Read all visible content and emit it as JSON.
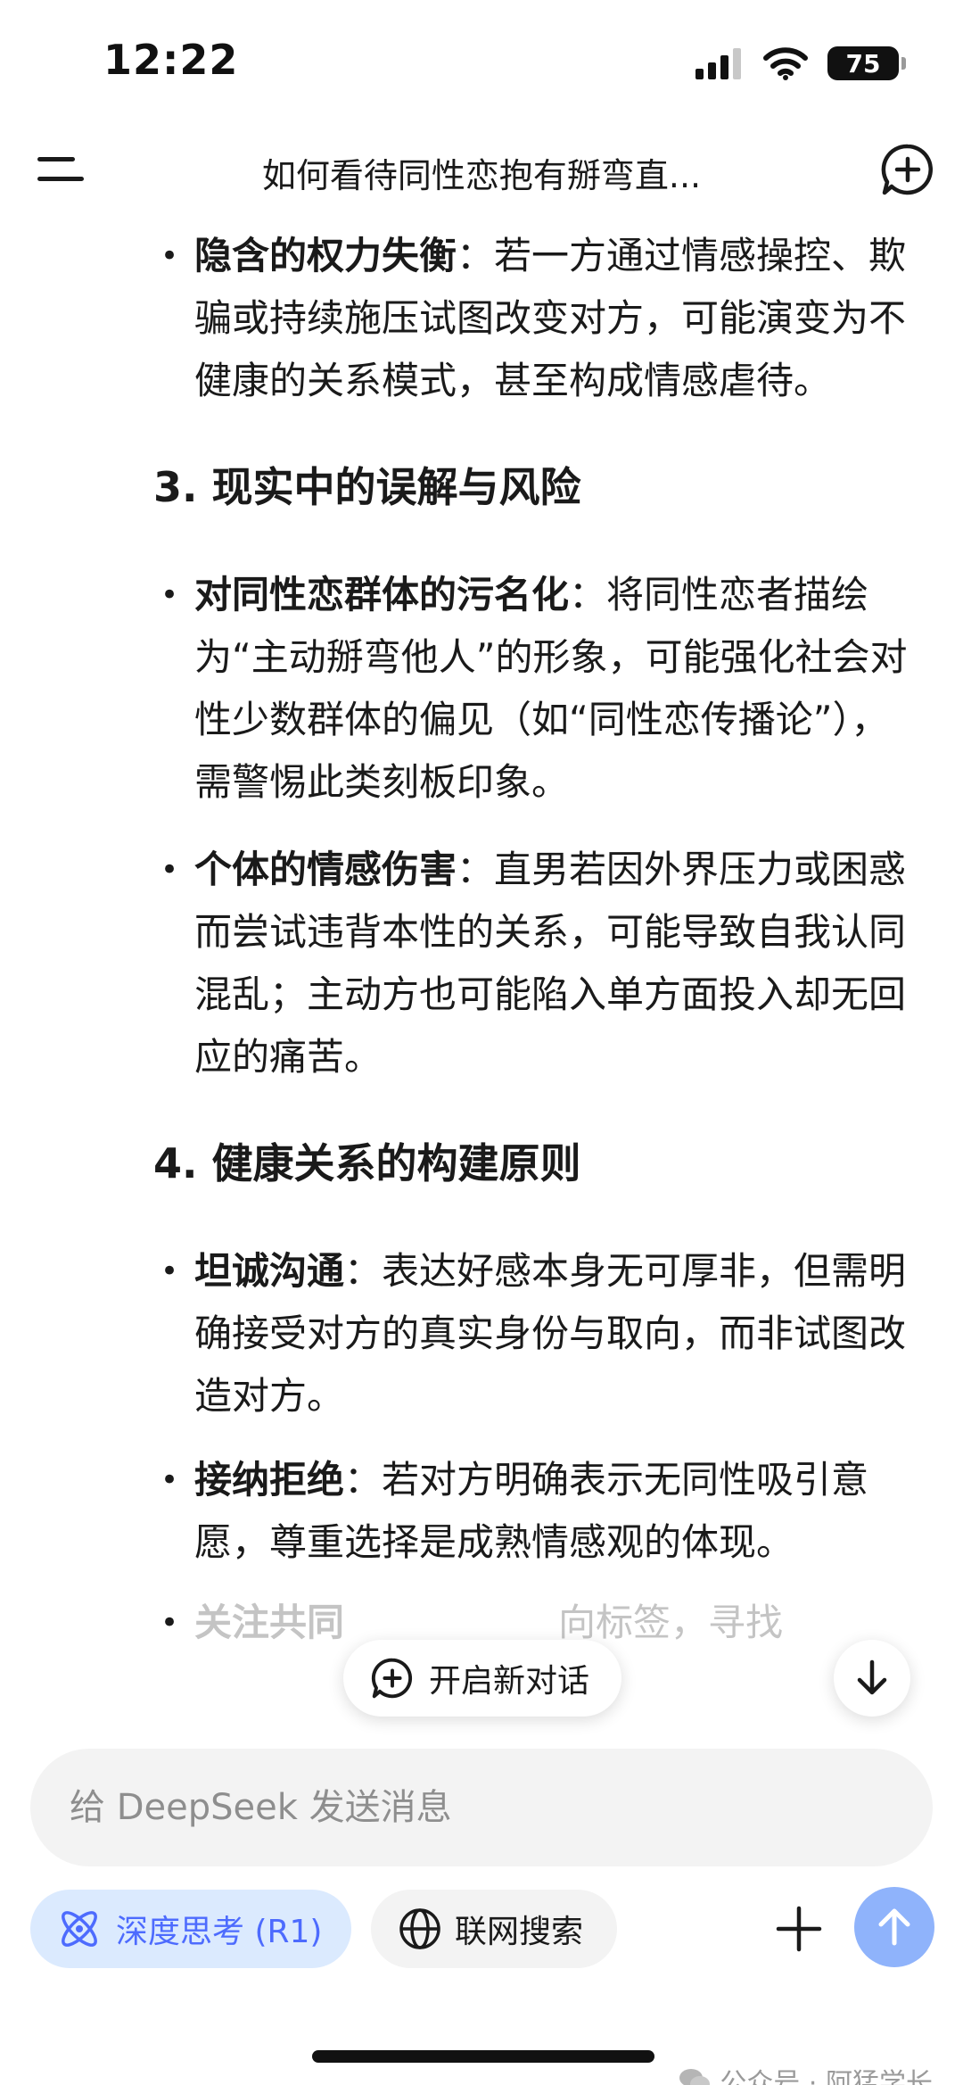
{
  "status_bar": {
    "time": "12:22",
    "battery": "75",
    "icons": [
      "signal-icon",
      "wifi-icon",
      "battery-icon"
    ]
  },
  "header": {
    "title": "如何看待同性恋抱有掰弯直...",
    "icons": [
      "menu-icon",
      "new-chat-icon"
    ]
  },
  "content": {
    "bullet_top": {
      "bold": "隐含的权力失衡",
      "text": "：若一方通过情感操控、欺骗或持续施压试图改变对方，可能演变为不健康的关系模式，甚至构成情感虐待。"
    },
    "section3": {
      "heading": "3. 现实中的误解与风险",
      "bullets": [
        {
          "bold": "对同性恋群体的污名化",
          "text": "：将同性恋者描绘为“主动掰弯他人”的形象，可能强化社会对性少数群体的偏见（如“同性恋传播论”），需警惕此类刻板印象。"
        },
        {
          "bold": "个体的情感伤害",
          "text": "：直男若因外界压力或困惑而尝试违背本性的关系，可能导致自我认同混乱；主动方也可能陷入单方面投入却无回应的痛苦。"
        }
      ]
    },
    "section4": {
      "heading": "4. 健康关系的构建原则",
      "bullets": [
        {
          "bold": "坦诚沟通",
          "text": "：表达好感本身无可厚非，但需明确接受对方的真实身份与取向，而非试图改造对方。"
        },
        {
          "bold": "接纳拒绝",
          "text": "：若对方明确表示无同性吸引意愿，尊重选择是成熟情感观的体现。"
        },
        {
          "bold": "关注共同",
          "text": "向标签，寻找"
        }
      ]
    }
  },
  "floating": {
    "new_chat_label": "开启新对话"
  },
  "input": {
    "placeholder": "给 DeepSeek 发送消息"
  },
  "toolbar": {
    "deep_think_label": "深度思考 (R1)",
    "web_search_label": "联网搜索",
    "accent_color": "#4d6bfe",
    "send_color": "#8fb3fb"
  },
  "watermark": {
    "text": "公众号 · 阿猛学长"
  }
}
